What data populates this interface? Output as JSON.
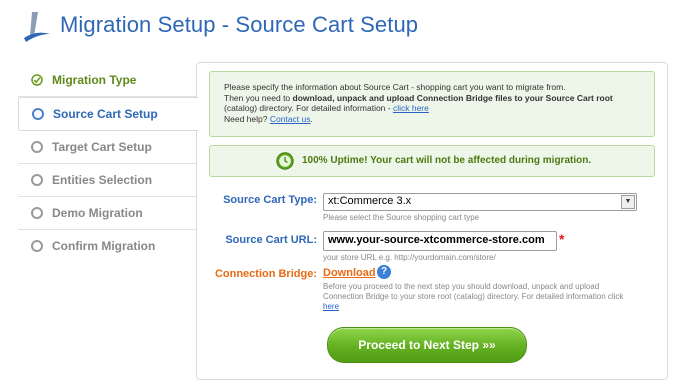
{
  "header": {
    "title": "Migration Setup - Source Cart Setup",
    "logo_icon": "wizard-pen-logo"
  },
  "sidebar": {
    "steps": [
      {
        "label": "Migration Type",
        "state": "done"
      },
      {
        "label": "Source Cart Setup",
        "state": "active"
      },
      {
        "label": "Target Cart Setup",
        "state": "pending"
      },
      {
        "label": "Entities Selection",
        "state": "pending"
      },
      {
        "label": "Demo Migration",
        "state": "pending"
      },
      {
        "label": "Confirm Migration",
        "state": "pending"
      }
    ]
  },
  "info": {
    "line1": "Please specify the information about Source Cart - shopping cart you want to migrate from.",
    "line2_pre": "Then you need to ",
    "line2_bold": "download, unpack and upload Connection Bridge files to your Source Cart root",
    "line3_pre": "(catalog) directory. For detailed information - ",
    "line3_link": "click here",
    "line4_pre": "Need help? ",
    "line4_link": "Contact us",
    "line4_post": "."
  },
  "uptime": {
    "text": "100% Uptime! Your cart will not be affected during migration."
  },
  "form": {
    "cart_type_label": "Source Cart Type:",
    "cart_type_value": "xt:Commerce 3.x",
    "cart_type_hint": "Please select the Source shopping cart type",
    "cart_url_label": "Source Cart URL:",
    "cart_url_value": "www.your-source-xtcommerce-store.com",
    "cart_url_required": "*",
    "cart_url_hint": "your store URL e.g. http://yourdomain.com/store/",
    "bridge_label": "Connection Bridge:",
    "bridge_download": "Download",
    "bridge_help": "?",
    "bridge_hint_1": "Before you proceed to the next step you should download, unpack and upload",
    "bridge_hint_2": "Connection Bridge to your store root (catalog) directory. For detailed information click",
    "bridge_hint_link": "here",
    "submit_label": "Proceed to Next Step »»"
  },
  "colors": {
    "accent": "#2f67b7",
    "success": "#63b021",
    "warning": "#e86a12"
  }
}
